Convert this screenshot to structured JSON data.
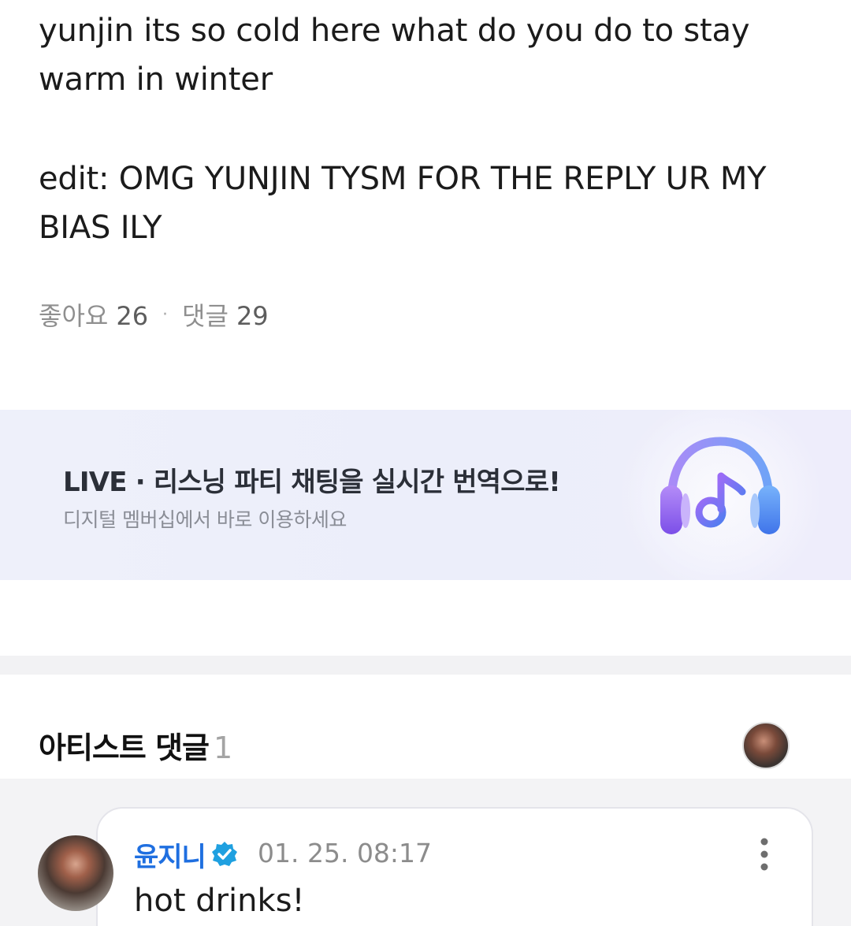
{
  "post": {
    "lines": [
      "yunjin its so cold here what do you do to stay",
      "warm in winter",
      "edit: OMG YUNJIN TYSM FOR THE REPLY UR MY",
      "BIAS ILY"
    ]
  },
  "meta": {
    "likes_label": "좋아요",
    "likes_count": "26",
    "separator": "·",
    "comments_label": "댓글",
    "comments_count": "29"
  },
  "banner": {
    "title": "LIVE · 리스닝 파티 채팅을 실시간 번역으로!",
    "subtitle": "디지털 멤버십에서 바로 이용하세요",
    "icon": "headphones-music-icon",
    "colors": {
      "headphone_purple": "#8a5cf6",
      "headphone_blue": "#4f8cf6"
    }
  },
  "artist_comments": {
    "title": "아티스트 댓글",
    "count": "1"
  },
  "comments": [
    {
      "author": "윤지니",
      "verified": true,
      "timestamp": "01. 25. 08:17",
      "text": "hot drinks!"
    }
  ],
  "colors": {
    "author_blue": "#1f6fe0",
    "verified_badge": "#1fa0e0"
  }
}
